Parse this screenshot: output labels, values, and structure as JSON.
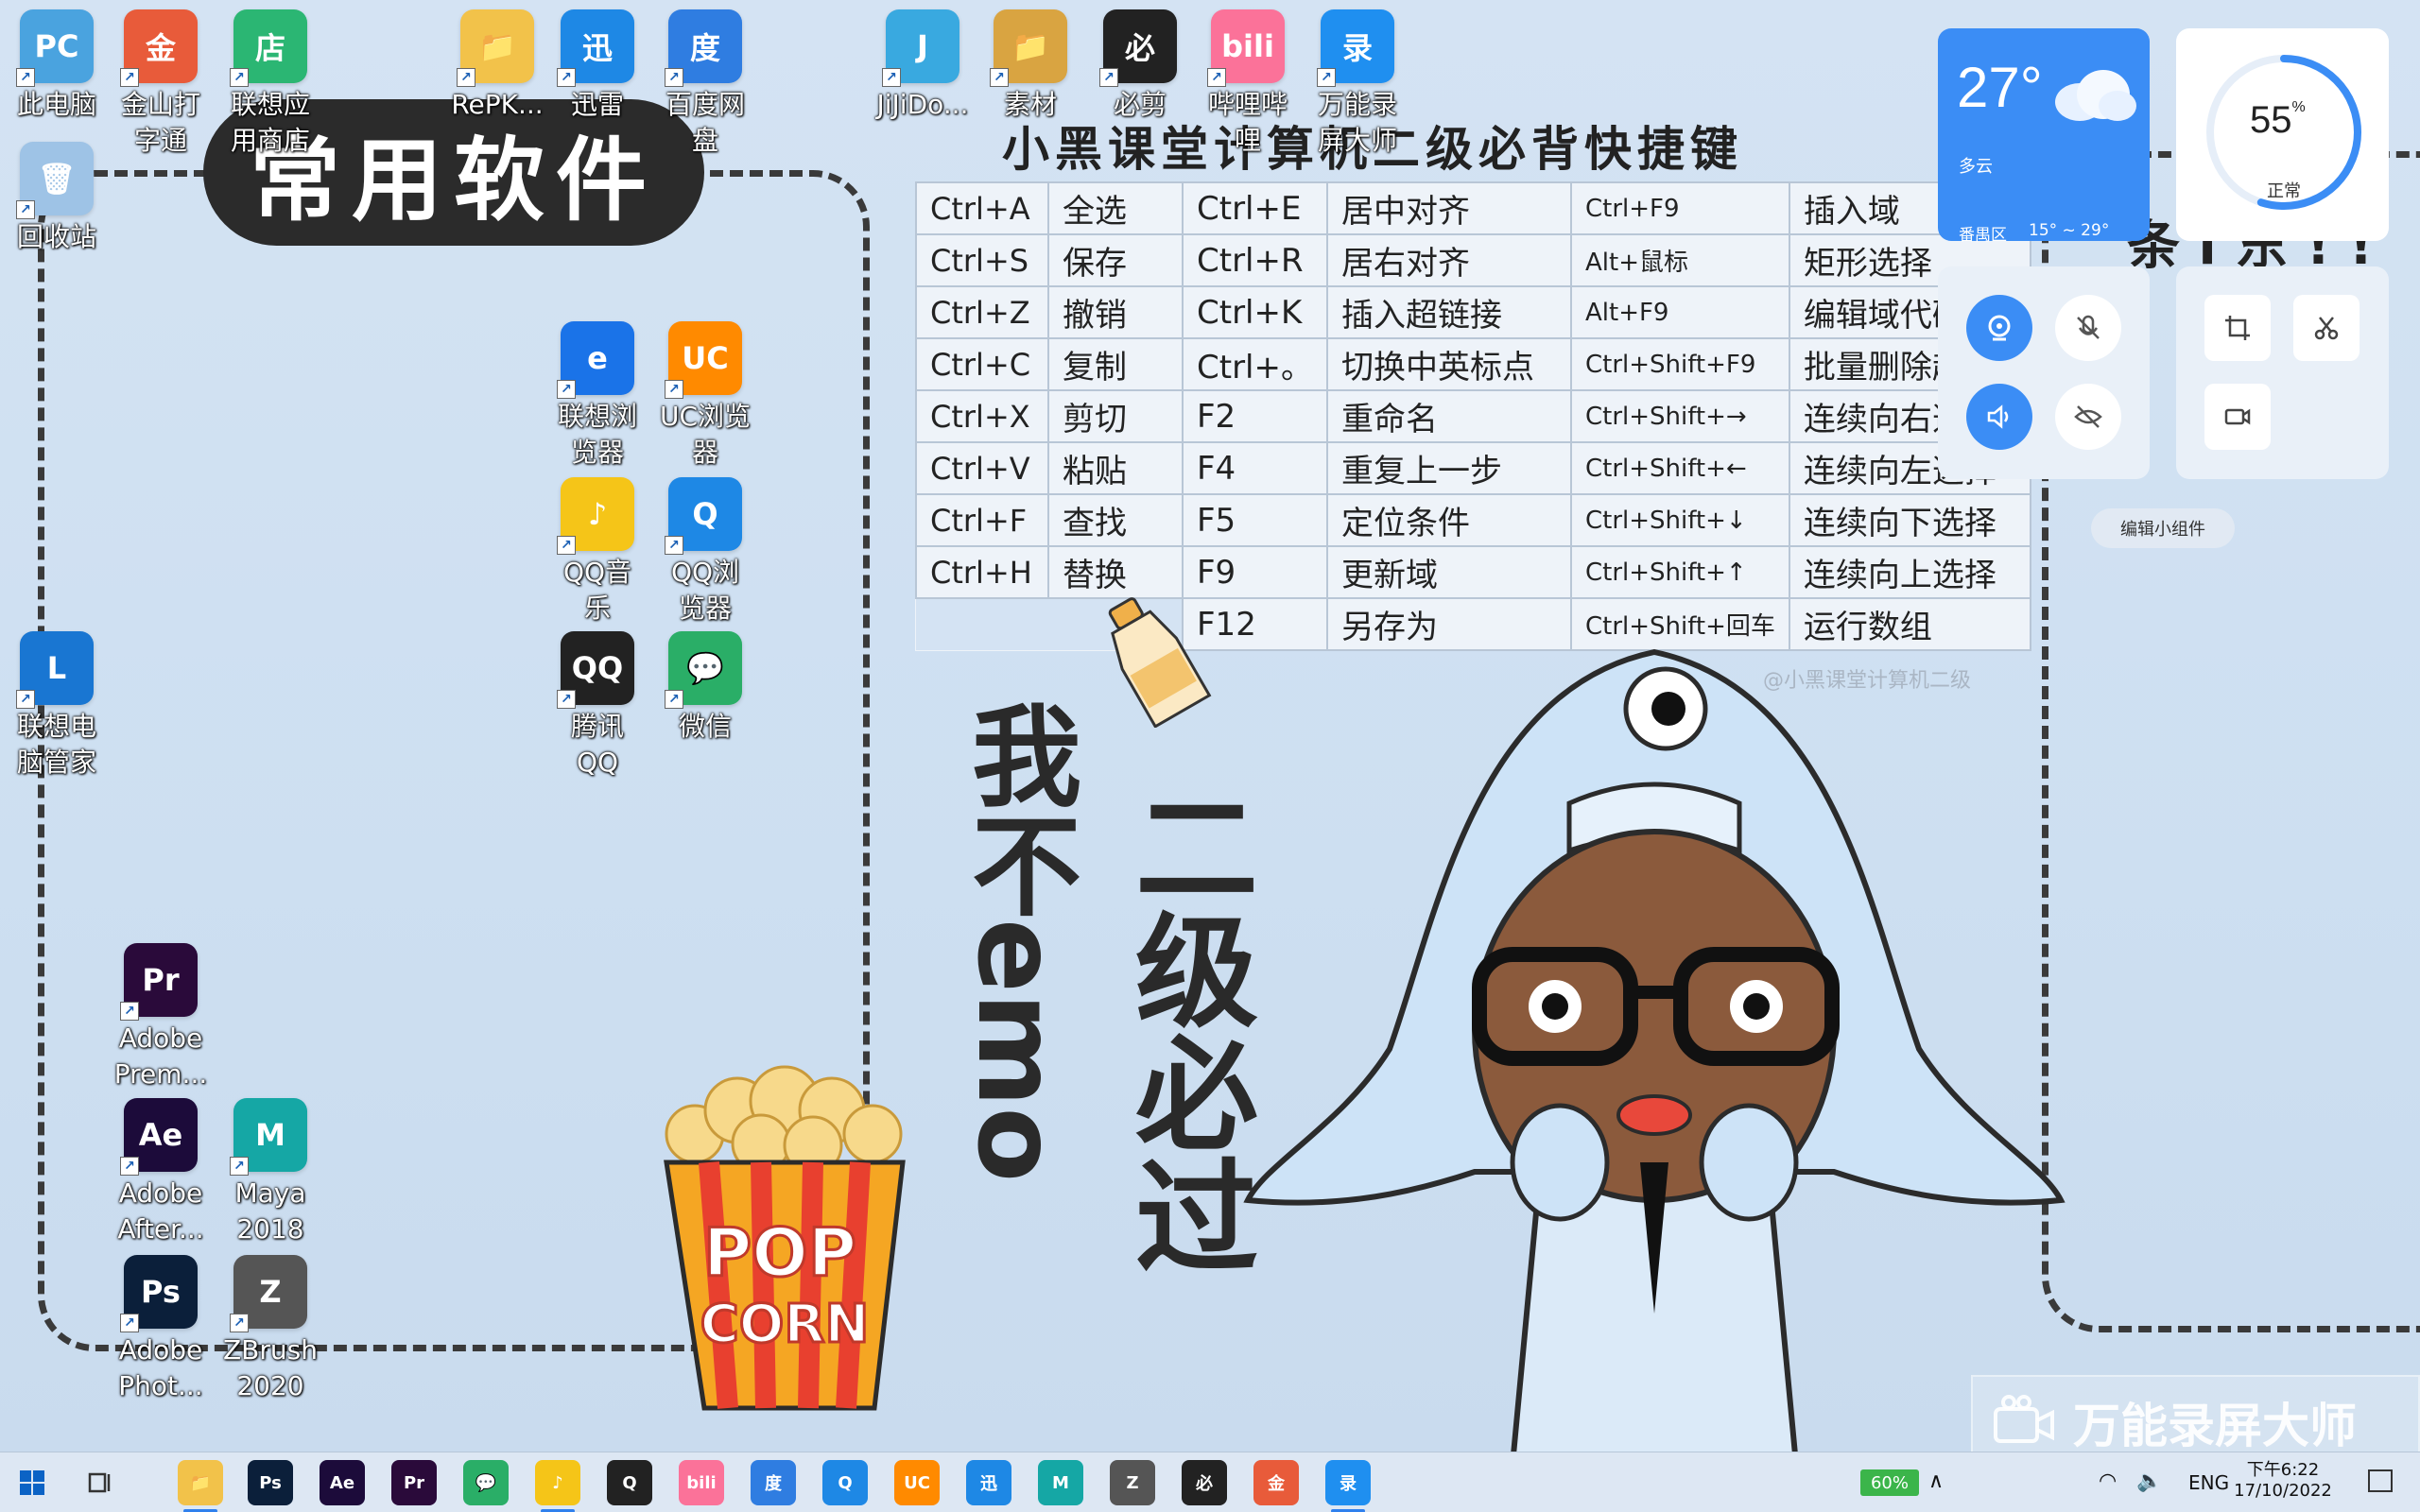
{
  "desktop": {
    "banner_title": "常用软件",
    "shortcut_title": "小黑课堂计算机二级必背快捷键",
    "motto_left": "我不emo",
    "motto_right": "二级必过",
    "small_watermark": "@小黑课堂计算机二级",
    "corner_text": "条 l 东 ! !",
    "icons": [
      {
        "label": "此电脑",
        "glyph": "PC",
        "color": "#4aa3df"
      },
      {
        "label": "金山打\n字通",
        "glyph": "金",
        "color": "#e85b3a"
      },
      {
        "label": "联想应\n用商店",
        "glyph": "店",
        "color": "#2bb673"
      },
      {
        "label": "RePK...",
        "glyph": "📁",
        "color": "#f2c24a"
      },
      {
        "label": "迅雷",
        "glyph": "迅",
        "color": "#1e88e5"
      },
      {
        "label": "百度网\n盘",
        "glyph": "度",
        "color": "#2f7de1"
      },
      {
        "label": "JiJiDo...",
        "glyph": "J",
        "color": "#39a9e0"
      },
      {
        "label": "素材",
        "glyph": "📁",
        "color": "#d9a441"
      },
      {
        "label": "必剪",
        "glyph": "必",
        "color": "#222222"
      },
      {
        "label": "哔哩哔\n哩",
        "glyph": "bili",
        "color": "#fb7299"
      },
      {
        "label": "万能录\n屏大师",
        "glyph": "录",
        "color": "#1f8ff0"
      },
      {
        "label": "回收站",
        "glyph": "🗑",
        "color": "#9ec3e6"
      },
      {
        "label": "联想浏\n览器",
        "glyph": "e",
        "color": "#1a73e8"
      },
      {
        "label": "UC浏览\n器",
        "glyph": "UC",
        "color": "#ff8a00"
      },
      {
        "label": "QQ音\n乐",
        "glyph": "♪",
        "color": "#f5c518"
      },
      {
        "label": "QQ浏\n览器",
        "glyph": "Q",
        "color": "#1e88e5"
      },
      {
        "label": "联想电\n脑管家",
        "glyph": "L",
        "color": "#1976d2"
      },
      {
        "label": "腾讯\nQQ",
        "glyph": "QQ",
        "color": "#222222"
      },
      {
        "label": "微信",
        "glyph": "💬",
        "color": "#2aae67"
      },
      {
        "label": "Adobe\nPrem...",
        "glyph": "Pr",
        "color": "#2a0a3a"
      },
      {
        "label": "Adobe\nAfter...",
        "glyph": "Ae",
        "color": "#1c0b3a"
      },
      {
        "label": "Maya\n2018",
        "glyph": "M",
        "color": "#15a7a5"
      },
      {
        "label": "Adobe\nPhot...",
        "glyph": "Ps",
        "color": "#0b1f3a"
      },
      {
        "label": "ZBrush\n2020",
        "glyph": "Z",
        "color": "#555555"
      }
    ]
  },
  "shortcuts": {
    "col1": [
      [
        "Ctrl+A",
        "全选"
      ],
      [
        "Ctrl+S",
        "保存"
      ],
      [
        "Ctrl+Z",
        "撤销"
      ],
      [
        "Ctrl+C",
        "复制"
      ],
      [
        "Ctrl+X",
        "剪切"
      ],
      [
        "Ctrl+V",
        "粘贴"
      ],
      [
        "Ctrl+F",
        "查找"
      ],
      [
        "Ctrl+H",
        "替换"
      ]
    ],
    "col2": [
      [
        "Ctrl+E",
        "居中对齐"
      ],
      [
        "Ctrl+R",
        "居右对齐"
      ],
      [
        "Ctrl+K",
        "插入超链接"
      ],
      [
        "Ctrl+。",
        "切换中英标点"
      ],
      [
        "F2",
        "重命名"
      ],
      [
        "F4",
        "重复上一步"
      ],
      [
        "F5",
        "定位条件"
      ],
      [
        "F9",
        "更新域"
      ],
      [
        "F12",
        "另存为"
      ]
    ],
    "col3": [
      [
        "Ctrl+F9",
        "插入域"
      ],
      [
        "Alt+鼠标",
        "矩形选择"
      ],
      [
        "Alt+F9",
        "编辑域代码"
      ],
      [
        "Ctrl+Shift+F9",
        "批量删除超链"
      ],
      [
        "Ctrl+Shift+→",
        "连续向右选"
      ],
      [
        "Ctrl+Shift+←",
        "连续向左选择"
      ],
      [
        "Ctrl+Shift+↓",
        "连续向下选择"
      ],
      [
        "Ctrl+Shift+↑",
        "连续向上选择"
      ],
      [
        "Ctrl+Shift+回车",
        "运行数组"
      ]
    ]
  },
  "widgets": {
    "weather": {
      "temp": "27°",
      "condition": "多云",
      "location": "番禺区",
      "range": "15° ~ 29°"
    },
    "performance": {
      "percent": "55",
      "unit": "%",
      "status": "正常",
      "value": 0.55
    },
    "edit_label": "编辑小组件"
  },
  "recorder_watermark": "万能录屏大师",
  "taskbar": {
    "battery": "60%",
    "language": "ENG",
    "time": "下午6:22",
    "date": "17/10/2022"
  }
}
